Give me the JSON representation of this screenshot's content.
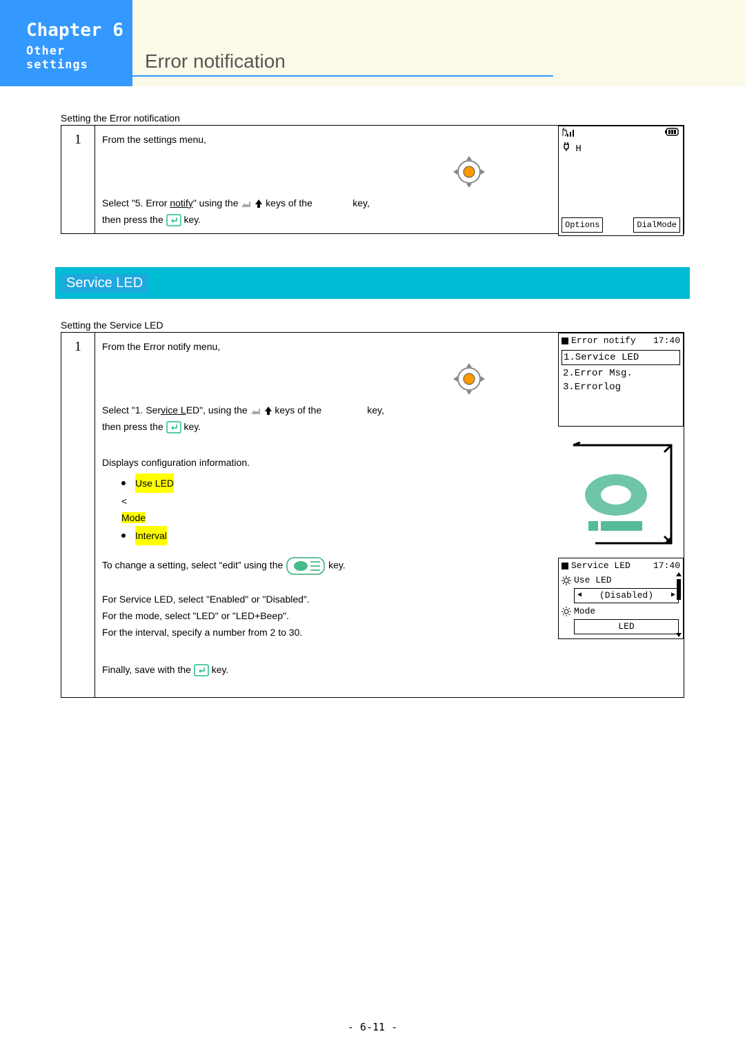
{
  "banner": {
    "chapter": "Chapter 6",
    "subtitle": "Other settings",
    "title": "Error notification"
  },
  "section1": {
    "caption": "Setting the Error notification",
    "step_num": "1",
    "line1": "From the settings menu,",
    "select": "Select \"5. Error ",
    "select_u": "notify",
    "select_tail": "\" using the ",
    "keys_of_the": " keys of the ",
    "key_word": "key,",
    "then_press": "then press the ",
    "key_tail": " key."
  },
  "lcd1": {
    "ch": "H",
    "soft_left": "Options",
    "soft_right": "DialMode"
  },
  "sectionbar": "Service  LED",
  "section2": {
    "caption": "Setting the Service LED",
    "step_num": "1",
    "line1": "From the Error notify menu,",
    "select_a": "Select \"1. Ser",
    "select_u": "vice L",
    "select_b": "ED\", using the ",
    "keys_of_the": " keys of the ",
    "key_word": "key,",
    "then_press": "then press the ",
    "key_tail": " key.",
    "displays": "Displays configuration information.",
    "bullets": [
      "Use LED",
      "Mode",
      "Interval"
    ],
    "to_change_a": "To change a setting, select “edit” using the ",
    "to_change_b": " key.",
    "for_service": "For Service LED, select \"Enabled\" or \"Disabled\".",
    "for_mode": "For the mode, select \"LED\" or \"LED+Beep\".",
    "for_interval": "For the interval, specify a number from 2 to 30.",
    "finally_a": "Finally, save with the ",
    "finally_b": " key."
  },
  "lcd2": {
    "title": "Error notify",
    "time": "17:40",
    "sel": "1.Service LED",
    "row2": "2.Error Msg.",
    "row3": "3.Errorlog"
  },
  "lcd3": {
    "title": "Service LED",
    "time": "17:40",
    "row1": "Use LED",
    "val1": "(Disabled)",
    "row2": "Mode",
    "val2": "LED"
  },
  "page_num": "- 6-11 -"
}
